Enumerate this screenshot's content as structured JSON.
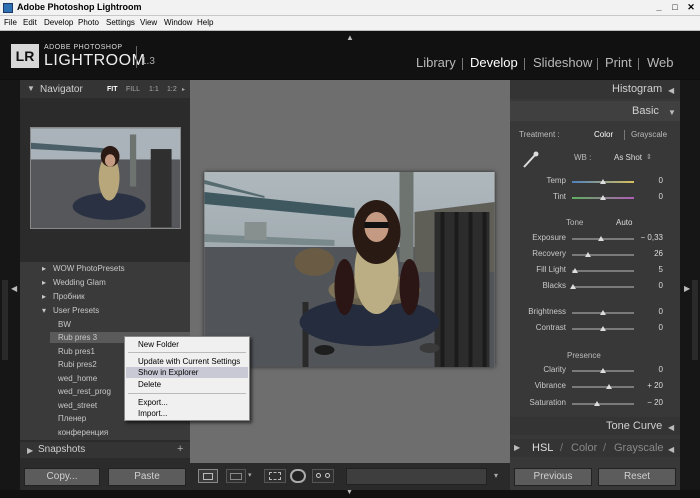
{
  "window": {
    "title": "Adobe Photoshop Lightroom",
    "min": "_",
    "max": "□",
    "close": "✕"
  },
  "menu": [
    "File",
    "Edit",
    "Develop",
    "Photo",
    "Settings",
    "View",
    "Window",
    "Help"
  ],
  "brand": {
    "logo": "LR",
    "line1": "ADOBE PHOTOSHOP",
    "line2": "LIGHTROOM",
    "version": "1.3"
  },
  "modules": [
    "Library",
    "Develop",
    "Slideshow",
    "Print",
    "Web"
  ],
  "navigator": {
    "title": "Navigator",
    "fit": "FIT",
    "fill": "FILL",
    "r1": "1:1",
    "r2": "1:2"
  },
  "presets": {
    "folders": [
      "WOW PhotoPresets",
      "Wedding Glam",
      "Пробник",
      "User Presets"
    ],
    "items": [
      "BW",
      "Rub pres 3",
      "Rub pres1",
      "Rubi pres2",
      "wed_home",
      "wed_rest_prog",
      "wed_street",
      "Пленер",
      "конференция"
    ]
  },
  "snapshots": {
    "title": "Snapshots",
    "add": "+"
  },
  "left_buttons": {
    "copy": "Copy...",
    "paste": "Paste"
  },
  "context_menu": [
    "New Folder",
    "Update with Current Settings",
    "Show in Explorer",
    "Delete",
    "Export...",
    "Import..."
  ],
  "right": {
    "histogram": "Histogram",
    "basic": "Basic",
    "treatment_label": "Treatment :",
    "treatment_color": "Color",
    "treatment_gray": "Grayscale",
    "wb_label": "WB :",
    "wb_value": "As Shot",
    "tone_label": "Tone",
    "auto": "Auto",
    "presence_label": "Presence",
    "tone_curve": "Tone Curve",
    "hsl": "HSL",
    "color": "Color",
    "grayscale": "Grayscale",
    "previous": "Previous",
    "reset": "Reset"
  },
  "sliders": [
    {
      "label": "Temp",
      "value": "0",
      "pos": 0.5
    },
    {
      "label": "Tint",
      "value": "0",
      "pos": 0.5
    },
    {
      "label": "Exposure",
      "value": "− 0,33",
      "pos": 0.46
    },
    {
      "label": "Recovery",
      "value": "26",
      "pos": 0.26
    },
    {
      "label": "Fill Light",
      "value": "5",
      "pos": 0.05
    },
    {
      "label": "Blacks",
      "value": "0",
      "pos": 0.02
    },
    {
      "label": "Brightness",
      "value": "0",
      "pos": 0.5
    },
    {
      "label": "Contrast",
      "value": "0",
      "pos": 0.5
    },
    {
      "label": "Clarity",
      "value": "0",
      "pos": 0.5
    },
    {
      "label": "Vibrance",
      "value": "+ 20",
      "pos": 0.6
    },
    {
      "label": "Saturation",
      "value": "− 20",
      "pos": 0.4
    }
  ]
}
